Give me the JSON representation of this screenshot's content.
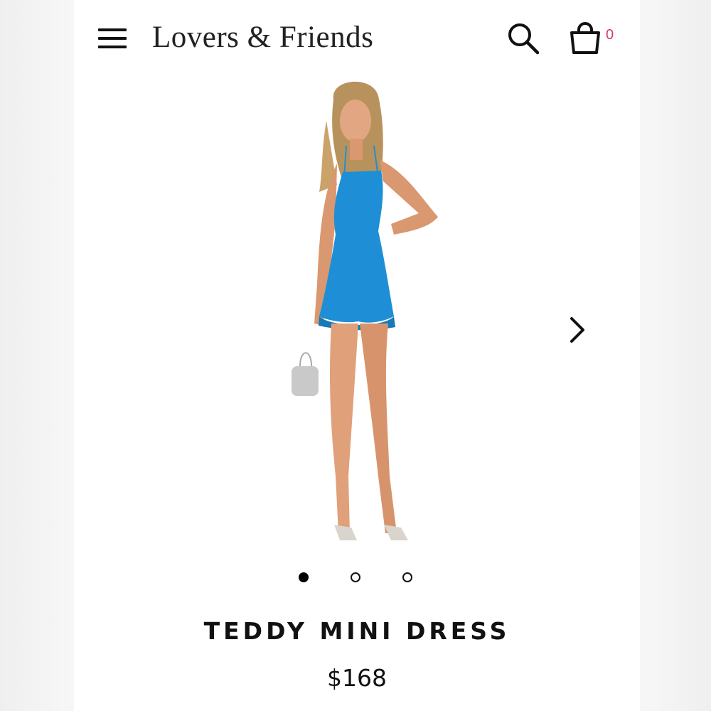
{
  "header": {
    "brand": "Lovers & Friends",
    "cart_count": "0",
    "cart_count_color": "#d6337f"
  },
  "icons": {
    "menu": "hamburger-menu-icon",
    "search": "search-icon",
    "cart": "shopping-bag-icon",
    "next": "chevron-right-icon"
  },
  "gallery": {
    "image_count": 3,
    "active_index": 0,
    "dress_color": "#1e8fd6"
  },
  "product": {
    "name": "TEDDY MINI DRESS",
    "price": "$168"
  }
}
